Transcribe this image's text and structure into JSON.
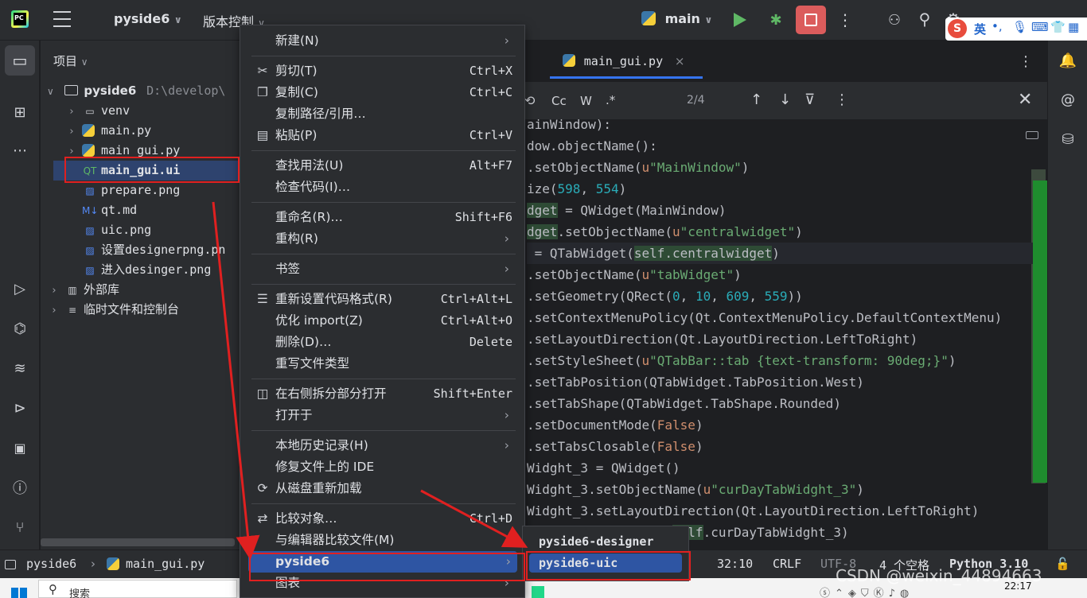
{
  "titlebar": {
    "project": "pyside6",
    "vcs": "版本控制",
    "run_config": "main",
    "ime_label": "英"
  },
  "project_panel": {
    "title": "项目",
    "root_name": "pyside6",
    "root_path": "D:\\develop\\",
    "items": [
      {
        "label": "venv",
        "icon": "folder-icon"
      },
      {
        "label": "main.py",
        "icon": "python-icon"
      },
      {
        "label": "main_gui.py",
        "icon": "python-icon"
      },
      {
        "label": "main_gui.ui",
        "icon": "qt-icon"
      },
      {
        "label": "prepare.png",
        "icon": "image-icon"
      },
      {
        "label": "qt.md",
        "icon": "markdown-icon"
      },
      {
        "label": "uic.png",
        "icon": "image-icon"
      },
      {
        "label": "设置designerpng.pn",
        "icon": "image-icon"
      },
      {
        "label": "进入desinger.png",
        "icon": "image-icon"
      },
      {
        "label": "外部库",
        "icon": "library-icon"
      },
      {
        "label": "临时文件和控制台",
        "icon": "scratch-icon"
      }
    ]
  },
  "editor": {
    "tab": "main_gui.py",
    "search": {
      "cc": "Cc",
      "w": "W",
      "regex": ".*",
      "count": "2/4"
    },
    "code": [
      [
        [
          "t",
          "ainWindow):"
        ]
      ],
      [
        [
          "t",
          "dow.objectName():"
        ]
      ],
      [
        [
          "t",
          ".setObjectName("
        ],
        [
          "kw",
          "u"
        ],
        [
          "str",
          "\"MainWindow\""
        ],
        [
          "t",
          ")"
        ]
      ],
      [
        [
          "t",
          "ize("
        ],
        [
          "num",
          "598"
        ],
        [
          "t",
          ", "
        ],
        [
          "num",
          "554"
        ],
        [
          "t",
          ")"
        ]
      ],
      [
        [
          "hl",
          "dget"
        ],
        [
          "t",
          " = QWidget(MainWindow)"
        ]
      ],
      [
        [
          "hl",
          "dget"
        ],
        [
          "t",
          ".setObjectName("
        ],
        [
          "kw",
          "u"
        ],
        [
          "str",
          "\"centralwidget\""
        ],
        [
          "t",
          ")"
        ]
      ],
      [
        [
          "t",
          " = QTabWidget("
        ],
        [
          "hl",
          "self.centralwidget"
        ],
        [
          "t",
          ")"
        ]
      ],
      [
        [
          "t",
          ".setObjectName("
        ],
        [
          "kw",
          "u"
        ],
        [
          "str",
          "\"tabWidget\""
        ],
        [
          "t",
          ")"
        ]
      ],
      [
        [
          "t",
          ".setGeometry(QRect("
        ],
        [
          "num",
          "0"
        ],
        [
          "t",
          ", "
        ],
        [
          "num",
          "10"
        ],
        [
          "t",
          ", "
        ],
        [
          "num",
          "609"
        ],
        [
          "t",
          ", "
        ],
        [
          "num",
          "559"
        ],
        [
          "t",
          "))"
        ]
      ],
      [
        [
          "t",
          ".setContextMenuPolicy(Qt.ContextMenuPolicy.DefaultContextMenu)"
        ]
      ],
      [
        [
          "t",
          ".setLayoutDirection(Qt.LayoutDirection.LeftToRight)"
        ]
      ],
      [
        [
          "t",
          ".setStyleSheet("
        ],
        [
          "kw",
          "u"
        ],
        [
          "str",
          "\"QTabBar::tab {text-transform: 90deg;}\""
        ],
        [
          "t",
          ")"
        ]
      ],
      [
        [
          "t",
          ".setTabPosition(QTabWidget.TabPosition.West)"
        ]
      ],
      [
        [
          "t",
          ".setTabShape(QTabWidget.TabShape.Rounded)"
        ]
      ],
      [
        [
          "t",
          ".setDocumentMode("
        ],
        [
          "kw",
          "False"
        ],
        [
          "t",
          ")"
        ]
      ],
      [
        [
          "t",
          ".setTabsClosable("
        ],
        [
          "kw",
          "False"
        ],
        [
          "t",
          ")"
        ]
      ],
      [
        [
          "t",
          "Widght_3 = QWidget()"
        ]
      ],
      [
        [
          "t",
          "Widght_3.setObjectName("
        ],
        [
          "kw",
          "u"
        ],
        [
          "str",
          "\"curDayTabWidght_3\""
        ],
        [
          "t",
          ")"
        ]
      ],
      [
        [
          "t",
          "Widght_3.setLayoutDirection(Qt.LayoutDirection.LeftToRight)"
        ]
      ],
      [
        [
          "t",
          "                et("
        ],
        [
          "hl",
          "self"
        ],
        [
          "t",
          ".curDayTabWidght_3)"
        ]
      ]
    ]
  },
  "context_menu": {
    "items": [
      {
        "label": "新建(N)",
        "shortcut": "",
        "arrow": true,
        "icon": ""
      },
      {
        "sep": true
      },
      {
        "label": "剪切(T)",
        "shortcut": "Ctrl+X",
        "icon": "scissors-icon"
      },
      {
        "label": "复制(C)",
        "shortcut": "Ctrl+C",
        "icon": "copy-icon"
      },
      {
        "label": "复制路径/引用…",
        "shortcut": "",
        "icon": ""
      },
      {
        "label": "粘贴(P)",
        "shortcut": "Ctrl+V",
        "icon": "paste-icon"
      },
      {
        "sep": true
      },
      {
        "label": "查找用法(U)",
        "shortcut": "Alt+F7",
        "icon": ""
      },
      {
        "label": "检查代码(I)…",
        "shortcut": "",
        "icon": ""
      },
      {
        "sep": true
      },
      {
        "label": "重命名(R)…",
        "shortcut": "Shift+F6",
        "icon": ""
      },
      {
        "label": "重构(R)",
        "shortcut": "",
        "arrow": true,
        "icon": ""
      },
      {
        "sep": true
      },
      {
        "label": "书签",
        "shortcut": "",
        "arrow": true,
        "icon": ""
      },
      {
        "sep": true
      },
      {
        "label": "重新设置代码格式(R)",
        "shortcut": "Ctrl+Alt+L",
        "icon": "format-icon"
      },
      {
        "label": "优化 import(Z)",
        "shortcut": "Ctrl+Alt+O",
        "icon": ""
      },
      {
        "label": "删除(D)…",
        "shortcut": "Delete",
        "icon": ""
      },
      {
        "label": "重写文件类型",
        "shortcut": "",
        "icon": ""
      },
      {
        "sep": true
      },
      {
        "label": "在右侧拆分部分打开",
        "shortcut": "Shift+Enter",
        "icon": "split-icon"
      },
      {
        "label": "打开于",
        "shortcut": "",
        "arrow": true,
        "icon": ""
      },
      {
        "sep": true
      },
      {
        "label": "本地历史记录(H)",
        "shortcut": "",
        "arrow": true,
        "icon": ""
      },
      {
        "label": "修复文件上的 IDE",
        "shortcut": "",
        "icon": ""
      },
      {
        "label": "从磁盘重新加载",
        "shortcut": "",
        "icon": "reload-icon"
      },
      {
        "sep": true
      },
      {
        "label": "比较对象…",
        "shortcut": "Ctrl+D",
        "icon": "compare-icon"
      },
      {
        "label": "与编辑器比较文件(M)",
        "shortcut": "",
        "icon": ""
      },
      {
        "label": "pyside6",
        "shortcut": "",
        "arrow": true,
        "icon": "",
        "selected": true
      },
      {
        "label": "图表",
        "shortcut": "",
        "arrow": true,
        "icon": ""
      }
    ]
  },
  "submenu": {
    "items": [
      {
        "label": "pyside6-designer"
      },
      {
        "label": "pyside6-uic",
        "selected": true
      }
    ]
  },
  "statusbar": {
    "crumb1": "pyside6",
    "crumb2": "main_gui.py",
    "position": "32:10",
    "line_sep": "CRLF",
    "encoding": "UTF-8",
    "indent": "4 个空格",
    "interpreter": "Python 3.10"
  },
  "taskbar": {
    "search": "搜索",
    "time": "22:17"
  },
  "watermark": "CSDN @weixin_44894663"
}
